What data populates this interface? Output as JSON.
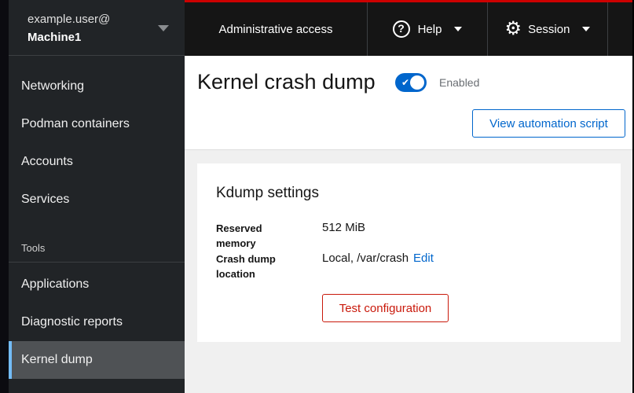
{
  "sidebar": {
    "user": "example.user@",
    "machine": "Machine1",
    "items": [
      "Networking",
      "Podman containers",
      "Accounts",
      "Services"
    ],
    "tools_label": "Tools",
    "tools": [
      "Applications",
      "Diagnostic reports",
      "Kernel dump"
    ],
    "active": "Kernel dump"
  },
  "topbar": {
    "admin": "Administrative access",
    "help": "Help",
    "session": "Session"
  },
  "page": {
    "title": "Kernel crash dump",
    "toggle_on": true,
    "status": "Enabled",
    "automation_button": "View automation script"
  },
  "card": {
    "title": "Kdump settings",
    "reserved_label": "Reserved memory",
    "reserved_value": "512 MiB",
    "location_label": "Crash dump location",
    "location_value": "Local, /var/crash",
    "edit_link": "Edit",
    "test_button": "Test configuration"
  }
}
